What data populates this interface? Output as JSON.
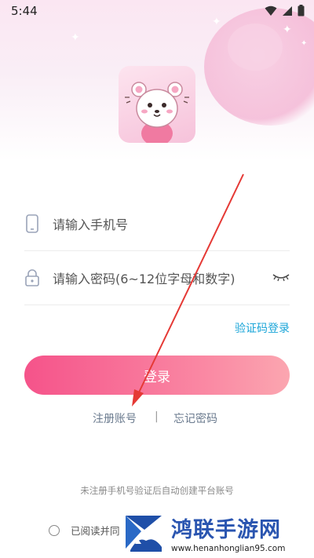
{
  "status_bar": {
    "time": "5:44"
  },
  "form": {
    "phone_placeholder": "请输入手机号",
    "password_placeholder": "请输入密码(6~12位字母和数字)",
    "code_login_link": "验证码登录",
    "login_button": "登录"
  },
  "links": {
    "register": "注册账号",
    "separator": "|",
    "forgot": "忘记密码"
  },
  "notice": "未注册手机号验证后自动创建平台账号",
  "agreement": {
    "text": "已阅读并同"
  },
  "watermark": {
    "title": "鸿联手游网",
    "url": "www.henanhonglian95.com"
  },
  "colors": {
    "accent_start": "#f5538a",
    "accent_end": "#fba6b0",
    "link": "#1aa5d8"
  }
}
